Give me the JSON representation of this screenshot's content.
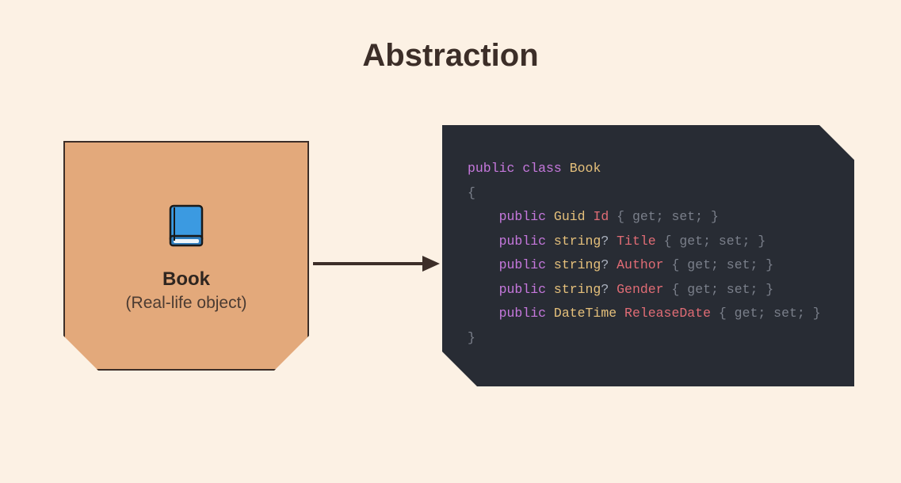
{
  "title": "Abstraction",
  "left": {
    "icon": "book-icon",
    "name": "Book",
    "subtitle": "(Real-life object)"
  },
  "code": {
    "line0_kw1": "public",
    "line0_kw2": "class",
    "line0_cls": "Book",
    "open_brace": "{",
    "close_brace": "}",
    "accessor_block": "{ get; set; }",
    "members": [
      {
        "kw": "public",
        "type": "Guid",
        "q": "",
        "name": "Id"
      },
      {
        "kw": "public",
        "type": "string",
        "q": "?",
        "name": "Title"
      },
      {
        "kw": "public",
        "type": "string",
        "q": "?",
        "name": "Author"
      },
      {
        "kw": "public",
        "type": "string",
        "q": "?",
        "name": "Gender"
      },
      {
        "kw": "public",
        "type": "DateTime",
        "q": "",
        "name": "ReleaseDate"
      }
    ]
  },
  "colors": {
    "bg": "#fcf1e4",
    "card": "#e3a97b",
    "border": "#3c2e28",
    "code_bg": "#282c34",
    "kw": "#c678dd",
    "type": "#e5c07b",
    "name": "#e06c75",
    "punc": "#abb2bf"
  }
}
